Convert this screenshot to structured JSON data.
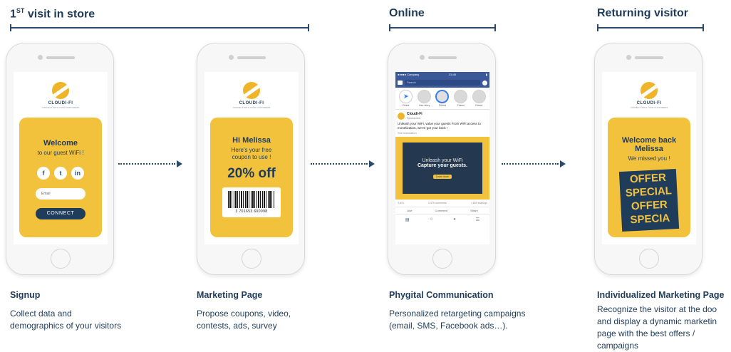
{
  "sections": [
    {
      "title_main": "1",
      "title_sup": "ST",
      "title_rest": " visit in store"
    },
    {
      "title_main": "Online",
      "title_sup": "",
      "title_rest": ""
    },
    {
      "title_main": "Returning visitor",
      "title_sup": "",
      "title_rest": ""
    }
  ],
  "brand": {
    "name": "CLOUDI-FI",
    "tagline": "CONNECT WITH YOUR CUSTOMERS",
    "accent": "#f3c23d",
    "navy": "#1f3c5a"
  },
  "phones": {
    "signup": {
      "welcome": "Welcome",
      "subtitle": "to our guest WiFi !",
      "social_icons": [
        "facebook-icon",
        "twitter-icon",
        "linkedin-icon"
      ],
      "social_labels": [
        "f",
        "t",
        "in"
      ],
      "email_placeholder": "Email",
      "connect_label": "CONNECT"
    },
    "marketing": {
      "greeting": "Hi Melissa",
      "line1": "Here's your free",
      "line2": "coupon to use !",
      "discount": "20% off",
      "barcode_number": "3 701653 600098"
    },
    "facebook": {
      "carrier": "●●●●● Company",
      "time": "23:40",
      "search_placeholder": "Search",
      "stories": [
        "Direct",
        "Your story",
        "Friend",
        "Friend",
        "Friend"
      ],
      "page_name": "Cloudi-Fi",
      "sponsored": "Sponsored",
      "post_text": "Unleash your WiFi, value your guests From WiFi access to monetization, we've got your back !",
      "see_translation": "See translation",
      "ad_line1": "Unleash your WiFi",
      "ad_line2": "Capture your guests.",
      "ad_button": "Learn more",
      "reactions": "3,876",
      "comments": "2,479 comments",
      "shares": "1,809 sharings",
      "actions": [
        "Like",
        "Comment",
        "Share"
      ]
    },
    "returning": {
      "greeting1": "Welcome back",
      "greeting2": "Melissa",
      "missed": "We missed you !",
      "offer_lines": [
        "OFFER",
        "SPECIAL",
        "OFFER",
        "SPECIA"
      ]
    }
  },
  "captions": [
    {
      "title": "Signup",
      "desc": [
        "Collect data and",
        "demographics of your visitors"
      ]
    },
    {
      "title": "Marketing Page",
      "desc": [
        "Propose coupons, video,",
        "contests, ads, survey"
      ]
    },
    {
      "title": "Phygital Communication",
      "desc": [
        "Personalized retargeting campaigns",
        "(email, SMS, Facebook ads…)."
      ]
    },
    {
      "title": "Individualized Marketing Page",
      "desc": [
        "Recognize the visitor at the doo",
        "and display a dynamic marketin",
        "page with the best offers /",
        "campaigns"
      ]
    }
  ]
}
